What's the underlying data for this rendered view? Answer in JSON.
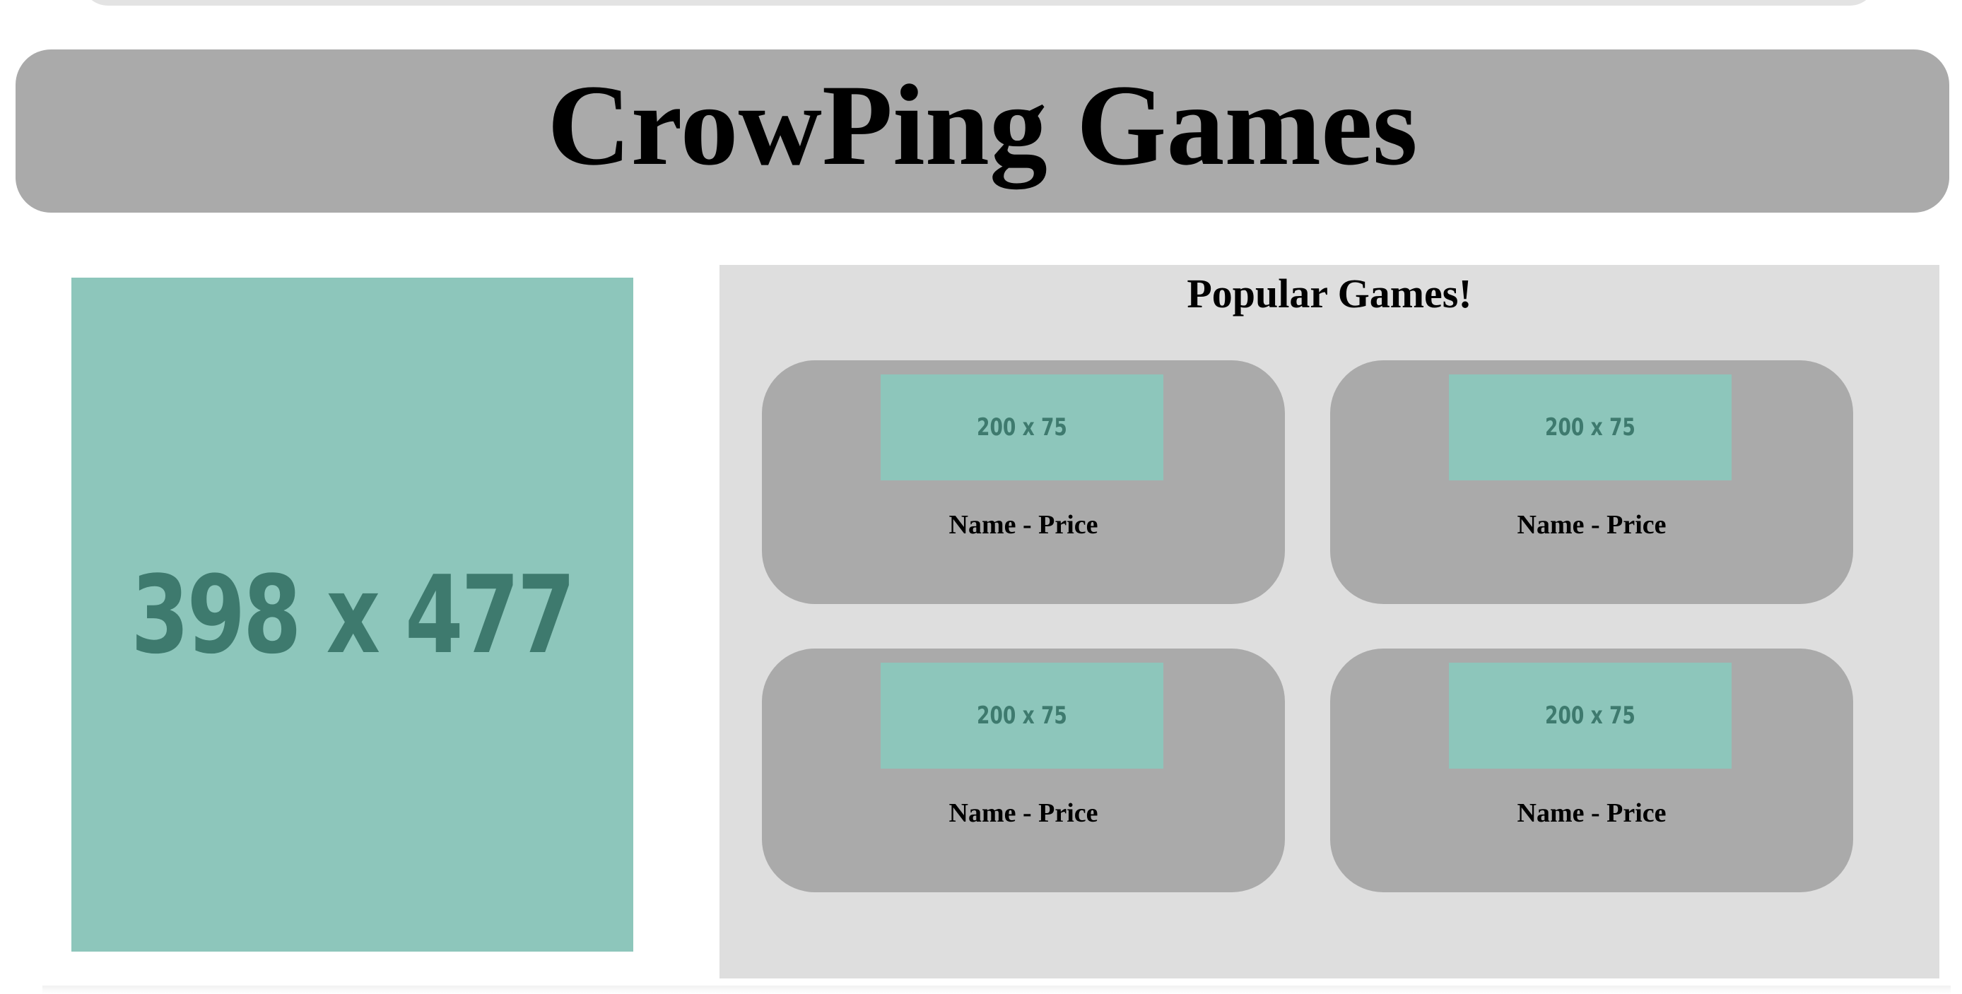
{
  "header": {
    "title": "CrowPing Games"
  },
  "hero": {
    "placeholder_label": "398 x 477"
  },
  "popular": {
    "title": "Popular Games!",
    "games": [
      {
        "thumb_label": "200 x 75",
        "caption": "Name - Price"
      },
      {
        "thumb_label": "200 x 75",
        "caption": "Name - Price"
      },
      {
        "thumb_label": "200 x 75",
        "caption": "Name - Price"
      },
      {
        "thumb_label": "200 x 75",
        "caption": "Name - Price"
      }
    ]
  },
  "colors": {
    "header_bg": "#aaaaaa",
    "panel_bg": "#dedede",
    "card_bg": "#aaaaaa",
    "placeholder_bg": "#8dc6bb",
    "placeholder_text": "#3e7a6e"
  }
}
